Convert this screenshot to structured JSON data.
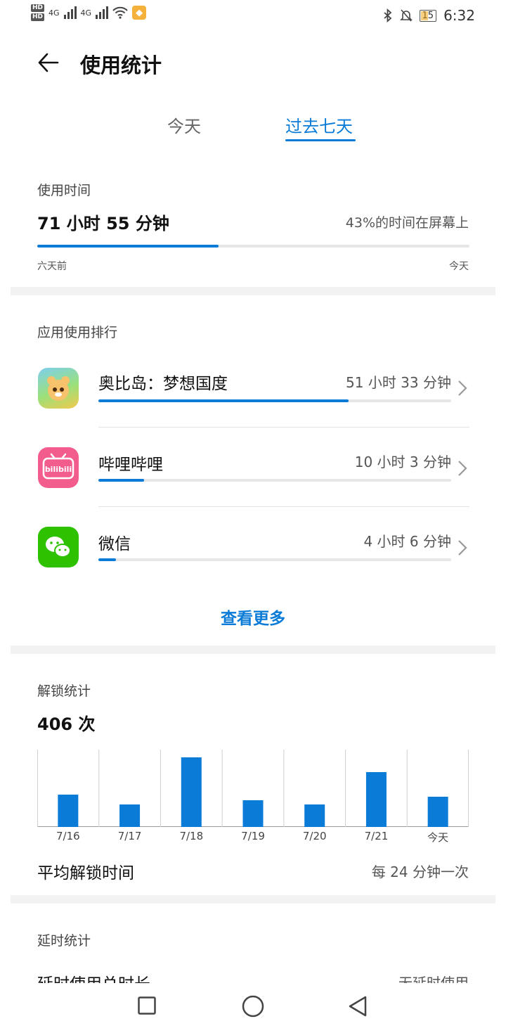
{
  "status_bar": {
    "time": "6:32",
    "battery": "15",
    "network_1": "4G",
    "network_2": "4G",
    "hd_1": "HD",
    "hd_2": "HD"
  },
  "header": {
    "title": "使用统计"
  },
  "tabs": [
    {
      "label": "今天"
    },
    {
      "label": "过去七天"
    }
  ],
  "usage": {
    "label": "使用时间",
    "total": "71 小时 55 分钟",
    "screen_percent": "43%的时间在屏幕上",
    "progress": 0.42,
    "start_label": "六天前",
    "end_label": "今天"
  },
  "ranking": {
    "label": "应用使用排行",
    "apps": [
      {
        "name": "奥比岛：梦想国度",
        "time": "51 小时 33 分钟",
        "fraction": 0.71,
        "icon": "obi-island-game-icon"
      },
      {
        "name": "哔哩哔哩",
        "time": "10 小时 3 分钟",
        "fraction": 0.13,
        "icon": "bilibili-icon"
      },
      {
        "name": "微信",
        "time": "4 小时 6 分钟",
        "fraction": 0.05,
        "icon": "wechat-icon"
      }
    ],
    "more_label": "查看更多"
  },
  "unlock": {
    "label": "解锁统计",
    "count": "406 次",
    "avg_label": "平均解锁时间",
    "avg_value": "每 24 分钟一次"
  },
  "chart_data": {
    "type": "bar",
    "categories": [
      "7/16",
      "7/17",
      "7/18",
      "7/19",
      "7/20",
      "7/21",
      "今天"
    ],
    "values": [
      46,
      32,
      99,
      38,
      32,
      78,
      43
    ],
    "ylim": [
      0,
      110
    ],
    "grid": "vertical separators",
    "color": "#0a7bd6"
  },
  "delay": {
    "label": "延时统计",
    "total_label": "延时使用总时长",
    "total_value": "无延时使用"
  },
  "colors": {
    "accent": "#0a7bd6",
    "bilibili": "#f25d8e",
    "wechat": "#2dc100"
  }
}
